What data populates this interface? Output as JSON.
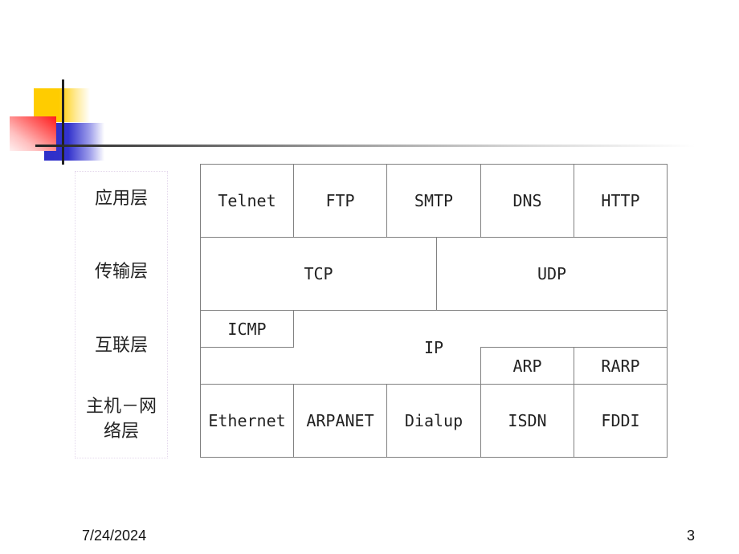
{
  "slide": {
    "date": "7/24/2024",
    "page_number": "3"
  },
  "layers": [
    {
      "label": "应用层"
    },
    {
      "label": "传输层"
    },
    {
      "label": "互联层"
    },
    {
      "label_line1": "主机－网",
      "label_line2": "络层"
    }
  ],
  "application_protocols": [
    "Telnet",
    "FTP",
    "SMTP",
    "DNS",
    "HTTP"
  ],
  "transport_protocols": [
    "TCP",
    "UDP"
  ],
  "internet_protocols": {
    "icmp": "ICMP",
    "ip": "IP",
    "arp": "ARP",
    "rarp": "RARP"
  },
  "network_access_protocols": [
    "Ethernet",
    "ARPANET",
    "Dialup",
    "ISDN",
    "FDDI"
  ],
  "colors": {
    "decor_yellow": "#ffcc00",
    "decor_red": "#ff1a1a",
    "decor_blue": "#3333cc",
    "table_border": "#808080"
  }
}
